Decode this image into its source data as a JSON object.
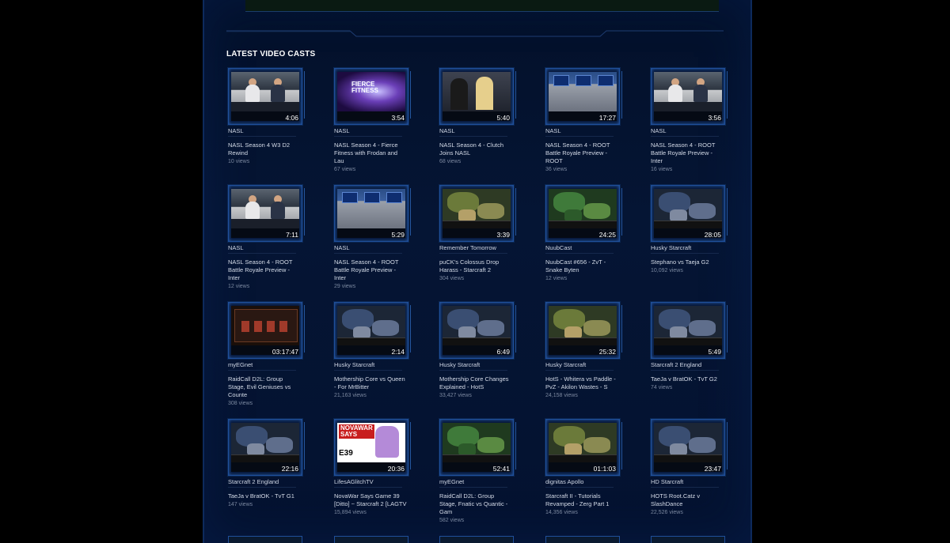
{
  "section_title": "LATEST VIDEO CASTS",
  "rows": [
    [
      {
        "channel": "NASL",
        "title": "NASL Season 4 W3 D2 Rewind",
        "views": "10 views",
        "duration": "4:06",
        "scene": "studio"
      },
      {
        "channel": "NASL",
        "title": "NASL Season 4 - Fierce Fitness with Frodan and Lau",
        "views": "67 views",
        "duration": "3:54",
        "scene": "fierce"
      },
      {
        "channel": "NASL",
        "title": "NASL Season 4 - Clutch Joins NASL",
        "views": "68 views",
        "duration": "5:40",
        "scene": "duo"
      },
      {
        "channel": "NASL",
        "title": "NASL Season 4 - ROOT Battle Royale Preview - ROOT",
        "views": "36 views",
        "duration": "17:27",
        "scene": "newsroom"
      },
      {
        "channel": "NASL",
        "title": "NASL Season 4 - ROOT Battle Royale Preview - Inter",
        "views": "16 views",
        "duration": "3:56",
        "scene": "studio"
      }
    ],
    [
      {
        "channel": "NASL",
        "title": "NASL Season 4 - ROOT Battle Royale Preview - Inter",
        "views": "12 views",
        "duration": "7:11",
        "scene": "studio"
      },
      {
        "channel": "NASL",
        "title": "NASL Season 4 - ROOT Battle Royale Preview - Inter",
        "views": "29 views",
        "duration": "5:29",
        "scene": "newsroom"
      },
      {
        "channel": "Remember Tomorrow",
        "title": "puCK's Colossus Drop Harass - Starcraft 2",
        "views": "304 views",
        "duration": "3:39",
        "scene": "sc"
      },
      {
        "channel": "NuubCast",
        "title": "NuubCast #656 - ZvT - Snake Byten",
        "views": "12 views",
        "duration": "24:25",
        "scene": "sc green"
      },
      {
        "channel": "Husky Starcraft",
        "title": "Stephano vs Taeja G2",
        "views": "10,092 views",
        "duration": "28:05",
        "scene": "sc blue"
      }
    ],
    [
      {
        "channel": "myEGnet",
        "title": "RaidCall D2L: Group Stage, Evil Geniuses vs Counte",
        "views": "308 views",
        "duration": "03:17:47",
        "scene": "game-ui"
      },
      {
        "channel": "Husky Starcraft",
        "title": "Mothership Core vs Queen - For MrBitter",
        "views": "21,163 views",
        "duration": "2:14",
        "scene": "sc blue"
      },
      {
        "channel": "Husky Starcraft",
        "title": "Mothership Core Changes Explained - HotS",
        "views": "33,427 views",
        "duration": "6:49",
        "scene": "sc blue"
      },
      {
        "channel": "Husky Starcraft",
        "title": "HotS - Whitera vs Paddle - PvZ - Akilon Wastes - S",
        "views": "24,158 views",
        "duration": "25:32",
        "scene": "sc"
      },
      {
        "channel": "Starcraft 2 England",
        "title": "TaeJa v BratOK - TvT G2",
        "views": "74 views",
        "duration": "5:49",
        "scene": "sc blue"
      }
    ],
    [
      {
        "channel": "Starcraft 2 England",
        "title": "TaeJa v BratOK - TvT G1",
        "views": "147 views",
        "duration": "22:16",
        "scene": "sc blue"
      },
      {
        "channel": "LifesAGlitchTV",
        "title": "NovaWar Says Game 39 [Ditto] ~ Starcraft 2 [LAGTV",
        "views": "15,894 views",
        "duration": "20:36",
        "scene": "nova"
      },
      {
        "channel": "myEGnet",
        "title": "RaidCall D2L: Group Stage, Fnatic vs Quantic - Gam",
        "views": "582 views",
        "duration": "52:41",
        "scene": "sc green"
      },
      {
        "channel": "dignitas Apollo",
        "title": "Starcraft II - Tutorials Revamped - Zerg Part 1",
        "views": "14,356 views",
        "duration": "01:1:03",
        "scene": "sc"
      },
      {
        "channel": "HD Starcraft",
        "title": "HOTS Root.Catz v SlashDance",
        "views": "22,526 views",
        "duration": "23:47",
        "scene": "sc blue"
      }
    ]
  ]
}
